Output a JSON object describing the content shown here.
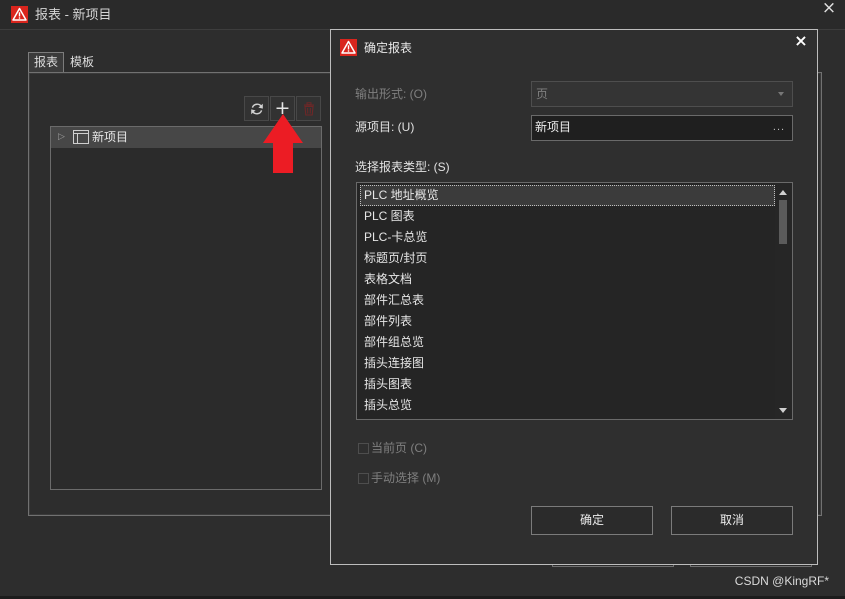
{
  "main_window": {
    "title": "报表 - 新项目",
    "close_glyph": "×",
    "tabs": [
      {
        "label": "报表",
        "selected": true
      },
      {
        "label": "模板",
        "selected": false
      }
    ],
    "toolbar": {
      "refresh_icon": "refresh-icon",
      "add_glyph": "+",
      "delete_icon": "trash-icon",
      "delete_enabled": false
    },
    "tree": {
      "items": [
        {
          "label": "新项目",
          "expand_glyph": "▷",
          "icon": "project-icon",
          "highlighted": true
        }
      ]
    }
  },
  "dialog": {
    "title": "确定报表",
    "close_glyph": "×",
    "output_form": {
      "label": "输出形式: (O)",
      "value": "页",
      "enabled": false
    },
    "source_project": {
      "label": "源项目: (U)",
      "value": "新项目",
      "browse_label": "..."
    },
    "report_type": {
      "label": "选择报表类型: (S)",
      "items": [
        "PLC 地址概览",
        "PLC 图表",
        "PLC-卡总览",
        "标题页/封页",
        "表格文档",
        "部件汇总表",
        "部件列表",
        "部件组总览",
        "插头连接图",
        "插头图表",
        "插头总览"
      ],
      "selected_index": 0,
      "scroll": {
        "position": 0,
        "visible_fraction": 0.22
      }
    },
    "current_page": {
      "label": "当前页 (C)",
      "checked": false,
      "enabled": false
    },
    "manual_select": {
      "label": "手动选择 (M)",
      "checked": false,
      "enabled": false
    },
    "buttons": {
      "ok": "确定",
      "cancel": "取消"
    }
  },
  "watermark": "CSDN @KingRF*",
  "colors": {
    "window_bg": "#2d2d2d",
    "dialog_bg": "#2f2f2f",
    "logo_red": "#d9251d",
    "annotation_arrow": "#ec1c24",
    "delete_icon": "#6e2727",
    "text": "#e0e0e0",
    "disabled_text": "#7f7f7f"
  }
}
